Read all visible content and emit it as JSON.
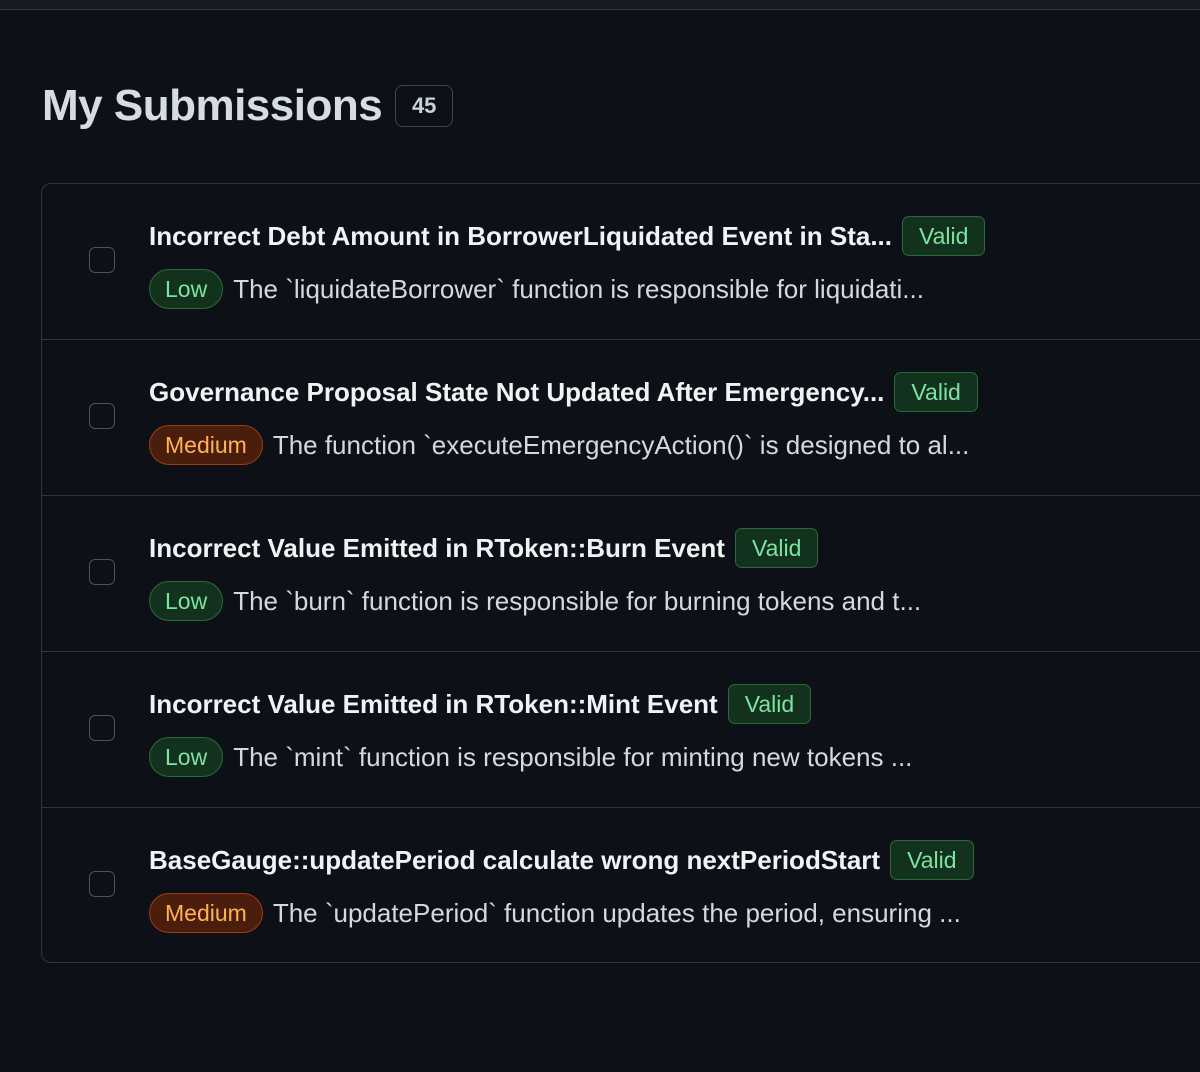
{
  "header": {
    "title": "My Submissions",
    "count": "45"
  },
  "submissions": [
    {
      "title": "Incorrect Debt Amount in BorrowerLiquidated Event in Sta...",
      "status": "Valid",
      "severity": "Low",
      "description": "The `liquidateBorrower` function is responsible for liquidati..."
    },
    {
      "title": "Governance Proposal State Not Updated After Emergency...",
      "status": "Valid",
      "severity": "Medium",
      "description": "The function `executeEmergencyAction()` is designed to al..."
    },
    {
      "title": "Incorrect Value Emitted in RToken::Burn Event",
      "status": "Valid",
      "severity": "Low",
      "description": "The `burn` function is responsible for burning tokens and t..."
    },
    {
      "title": "Incorrect Value Emitted in RToken::Mint Event",
      "status": "Valid",
      "severity": "Low",
      "description": "The `mint` function is responsible for minting new tokens ..."
    },
    {
      "title": "BaseGauge::updatePeriod calculate wrong nextPeriodStart",
      "status": "Valid",
      "severity": "Medium",
      "description": "The `updatePeriod` function updates the period, ensuring ..."
    }
  ],
  "colors": {
    "background": "#0d1117",
    "valid_green": "#7ee2a0",
    "low_green": "#7ee2a0",
    "medium_orange": "#ffb357"
  }
}
